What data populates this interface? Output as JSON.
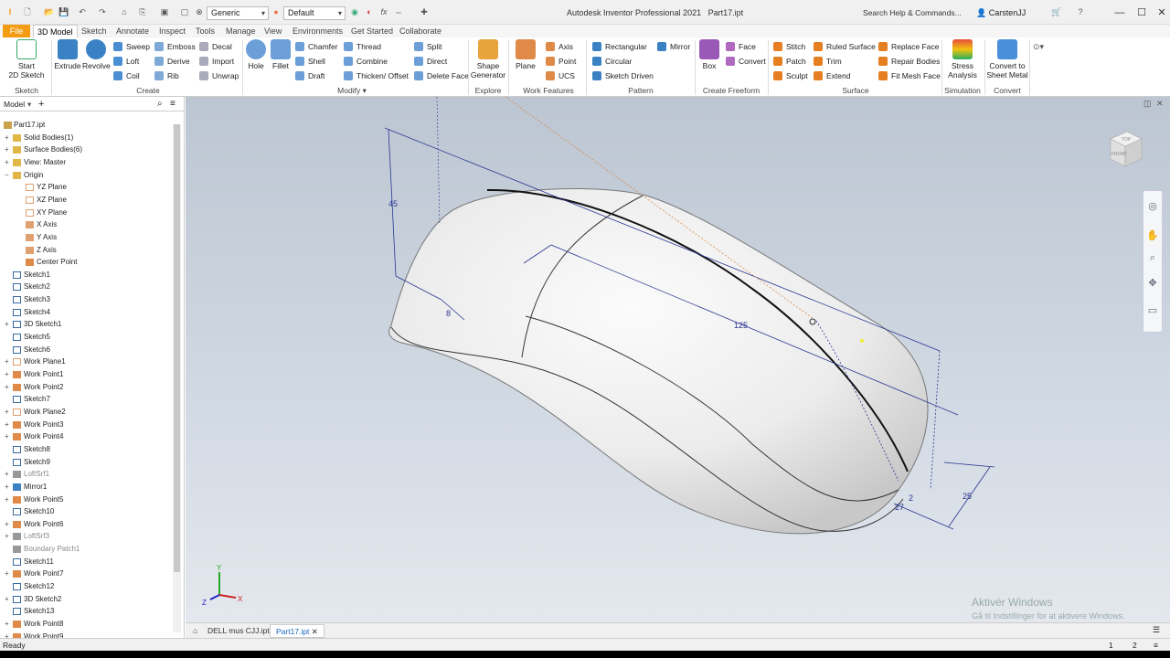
{
  "titlebar": {
    "app_title": "Autodesk Inventor Professional 2021",
    "doc_name": "Part17.ipt",
    "material": "Generic",
    "appearance": "Default",
    "search_placeholder": "Search Help & Commands...",
    "user": "CarstenJJ"
  },
  "tabs": [
    "File",
    "3D Model",
    "Sketch",
    "Annotate",
    "Inspect",
    "Tools",
    "Manage",
    "View",
    "Environments",
    "Get Started",
    "Collaborate"
  ],
  "ribbon": {
    "sketch": {
      "start": "Start",
      "start2": "2D Sketch",
      "title": "Sketch"
    },
    "create": {
      "extrude": "Extrude",
      "revolve": "Revolve",
      "sweep": "Sweep",
      "loft": "Loft",
      "coil": "Coil",
      "emboss": "Emboss",
      "derive": "Derive",
      "rib": "Rib",
      "decal": "Decal",
      "import": "Import",
      "unwrap": "Unwrap",
      "title": "Create"
    },
    "modify": {
      "hole": "Hole",
      "fillet": "Fillet",
      "chamfer": "Chamfer",
      "shell": "Shell",
      "draft": "Draft",
      "thread": "Thread",
      "combine": "Combine",
      "thicken": "Thicken/ Offset",
      "split": "Split",
      "direct": "Direct",
      "deleteface": "Delete Face",
      "title": "Modify"
    },
    "explore": {
      "shape": "Shape",
      "generator": "Generator",
      "title": "Explore"
    },
    "workfeatures": {
      "plane": "Plane",
      "axis": "Axis",
      "point": "Point",
      "ucs": "UCS",
      "title": "Work Features"
    },
    "pattern": {
      "rectangular": "Rectangular",
      "circular": "Circular",
      "sketchdriven": "Sketch Driven",
      "mirror": "Mirror",
      "title": "Pattern"
    },
    "freeform": {
      "box": "Box",
      "face": "Face",
      "convert": "Convert",
      "title": "Create Freeform"
    },
    "surface": {
      "stitch": "Stitch",
      "patch": "Patch",
      "sculpt": "Sculpt",
      "ruled": "Ruled Surface",
      "trim": "Trim",
      "extend": "Extend",
      "replace": "Replace Face",
      "repair": "Repair Bodies",
      "fitmesh": "Fit Mesh Face",
      "title": "Surface"
    },
    "simulation": {
      "stress": "Stress",
      "analysis": "Analysis",
      "title": "Simulation"
    },
    "convert": {
      "c1": "Convert to",
      "c2": "Sheet Metal",
      "title": "Convert"
    }
  },
  "browser": {
    "label": "Model",
    "items": [
      {
        "label": "Part17.ipt",
        "type": "part",
        "exp": ""
      },
      {
        "label": "Solid Bodies(1)",
        "type": "folder",
        "exp": "+"
      },
      {
        "label": "Surface Bodies(6)",
        "type": "folder",
        "exp": "+"
      },
      {
        "label": "View: Master",
        "type": "folder",
        "exp": "+"
      },
      {
        "label": "Origin",
        "type": "folder",
        "exp": "−"
      },
      {
        "label": "YZ Plane",
        "type": "plane",
        "exp": "",
        "indent": 1
      },
      {
        "label": "XZ Plane",
        "type": "plane",
        "exp": "",
        "indent": 1
      },
      {
        "label": "XY Plane",
        "type": "plane",
        "exp": "",
        "indent": 1
      },
      {
        "label": "X Axis",
        "type": "axis",
        "exp": "",
        "indent": 1
      },
      {
        "label": "Y Axis",
        "type": "axis",
        "exp": "",
        "indent": 1
      },
      {
        "label": "Z Axis",
        "type": "axis",
        "exp": "",
        "indent": 1
      },
      {
        "label": "Center Point",
        "type": "point",
        "exp": "",
        "indent": 1
      },
      {
        "label": "Sketch1",
        "type": "sketch",
        "exp": ""
      },
      {
        "label": "Sketch2",
        "type": "sketch",
        "exp": ""
      },
      {
        "label": "Sketch3",
        "type": "sketch",
        "exp": ""
      },
      {
        "label": "Sketch4",
        "type": "sketch",
        "exp": ""
      },
      {
        "label": "3D Sketch1",
        "type": "sketch",
        "exp": "+"
      },
      {
        "label": "Sketch5",
        "type": "sketch",
        "exp": ""
      },
      {
        "label": "Sketch6",
        "type": "sketch",
        "exp": ""
      },
      {
        "label": "Work Plane1",
        "type": "plane",
        "exp": "+"
      },
      {
        "label": "Work Point1",
        "type": "point",
        "exp": "+"
      },
      {
        "label": "Work Point2",
        "type": "point",
        "exp": "+"
      },
      {
        "label": "Sketch7",
        "type": "sketch",
        "exp": ""
      },
      {
        "label": "Work Plane2",
        "type": "plane",
        "exp": "+"
      },
      {
        "label": "Work Point3",
        "type": "point",
        "exp": "+"
      },
      {
        "label": "Work Point4",
        "type": "point",
        "exp": "+"
      },
      {
        "label": "Sketch8",
        "type": "sketch",
        "exp": ""
      },
      {
        "label": "Sketch9",
        "type": "sketch",
        "exp": ""
      },
      {
        "label": "LoftSrf1",
        "type": "surf",
        "exp": "+",
        "dim": true
      },
      {
        "label": "Mirror1",
        "type": "mirror",
        "exp": "+"
      },
      {
        "label": "Work Point5",
        "type": "point",
        "exp": "+"
      },
      {
        "label": "Sketch10",
        "type": "sketch",
        "exp": ""
      },
      {
        "label": "Work Point6",
        "type": "point",
        "exp": "+"
      },
      {
        "label": "LoftSrf3",
        "type": "surf",
        "exp": "+",
        "dim": true
      },
      {
        "label": "Boundary Patch1",
        "type": "surf",
        "exp": "",
        "dim": true
      },
      {
        "label": "Sketch11",
        "type": "sketch",
        "exp": ""
      },
      {
        "label": "Work Point7",
        "type": "point",
        "exp": "+"
      },
      {
        "label": "Sketch12",
        "type": "sketch",
        "exp": ""
      },
      {
        "label": "3D Sketch2",
        "type": "sketch",
        "exp": "+"
      },
      {
        "label": "Sketch13",
        "type": "sketch",
        "exp": ""
      },
      {
        "label": "Work Point8",
        "type": "point",
        "exp": "+"
      },
      {
        "label": "Work Point9",
        "type": "point",
        "exp": "+"
      }
    ]
  },
  "viewport": {
    "dims": [
      "45",
      "8",
      "125",
      "25",
      "2",
      "27"
    ],
    "viewcube_top": "TOP",
    "viewcube_front": "FRONT",
    "axes": {
      "x": "X",
      "y": "Y",
      "z": "Z"
    }
  },
  "doctabs": [
    "DELL mus CJJ.ipt",
    "Part17.ipt"
  ],
  "status": {
    "text": "Ready",
    "n1": "1",
    "n2": "2"
  },
  "watermark": {
    "line1": "Aktivér Windows",
    "line2": "Gå til Indstillinger for at aktivere Windows."
  },
  "colors": {
    "file_tab": "#f39c12",
    "accent": "#1565c0",
    "sketch_line": "#2a3590"
  }
}
